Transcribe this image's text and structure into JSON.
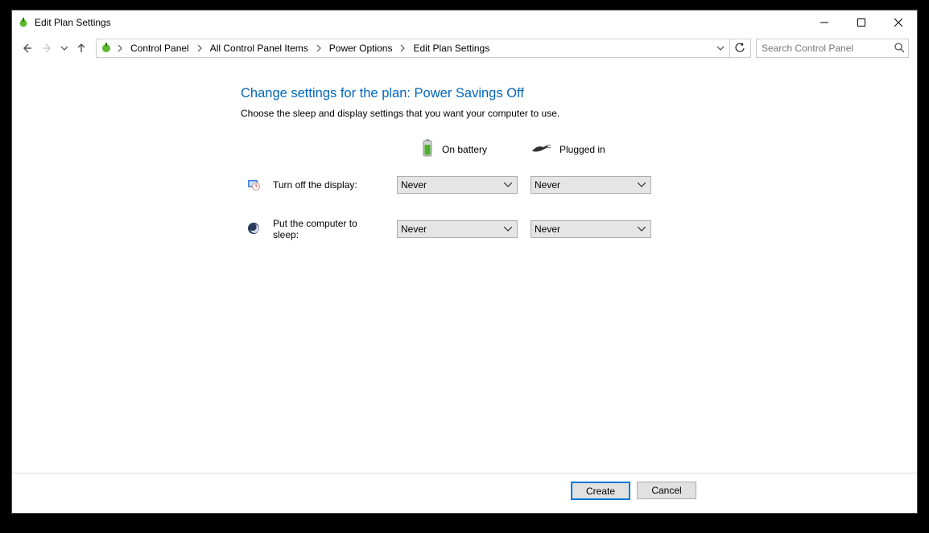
{
  "window": {
    "title": "Edit Plan Settings"
  },
  "breadcrumbs": {
    "items": [
      {
        "label": "Control Panel"
      },
      {
        "label": "All Control Panel Items"
      },
      {
        "label": "Power Options"
      },
      {
        "label": "Edit Plan Settings"
      }
    ]
  },
  "search": {
    "placeholder": "Search Control Panel"
  },
  "plan": {
    "heading": "Change settings for the plan: Power Savings Off",
    "subheading": "Choose the sleep and display settings that you want your computer to use.",
    "columns": {
      "battery": "On battery",
      "plugged": "Plugged in"
    },
    "rows": [
      {
        "icon": "display-timer-icon",
        "label": "Turn off the display:",
        "battery_value": "Never",
        "plugged_value": "Never"
      },
      {
        "icon": "sleep-moon-icon",
        "label": "Put the computer to sleep:",
        "battery_value": "Never",
        "plugged_value": "Never"
      }
    ]
  },
  "buttons": {
    "create": "Create",
    "cancel": "Cancel"
  }
}
